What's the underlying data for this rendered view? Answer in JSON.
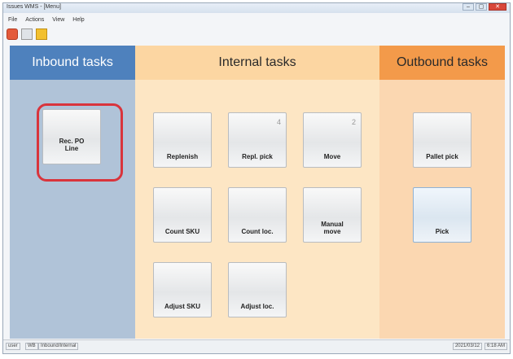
{
  "window": {
    "title": "Issues WMS - [Menu]",
    "buttons": [
      "–",
      "▢",
      "✕"
    ]
  },
  "menu": [
    "File",
    "Actions",
    "View",
    "Help"
  ],
  "columns": {
    "inbound": {
      "title": "Inbound tasks",
      "tiles": [
        {
          "label": "Rec. PO Line",
          "highlighted": true
        }
      ]
    },
    "internal": {
      "title": "Internal tasks",
      "tiles": [
        {
          "label": "Replenish",
          "count": ""
        },
        {
          "label": "Repl. pick",
          "count": "4"
        },
        {
          "label": "Move",
          "count": "2"
        },
        {
          "label": "Count SKU",
          "count": ""
        },
        {
          "label": "Count loc.",
          "count": ""
        },
        {
          "label": "Manual move",
          "count": ""
        },
        {
          "label": "Adjust SKU",
          "count": ""
        },
        {
          "label": "Adjust loc.",
          "count": ""
        }
      ]
    },
    "outbound": {
      "title": "Outbound tasks",
      "tiles": [
        {
          "label": "Pallet pick",
          "selected": false
        },
        {
          "label": "Pick",
          "selected": true
        }
      ]
    }
  },
  "status": {
    "left": [
      "user",
      "WB",
      "Inbound/Internal"
    ],
    "right": [
      "2021/03/12",
      "6:18 AM"
    ]
  },
  "colors": {
    "inbound_header": "#4e81bd",
    "internal_header": "#fcd6a2",
    "outbound_header": "#f39a4a",
    "highlight": "#d9343c"
  }
}
